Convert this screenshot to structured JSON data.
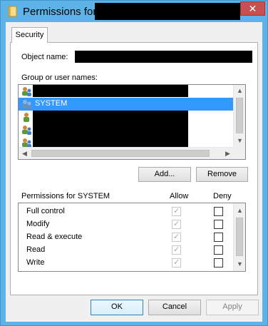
{
  "window": {
    "title": "Permissions for",
    "close_label": "✕"
  },
  "tabs": [
    {
      "label": "Security"
    }
  ],
  "object": {
    "label": "Object name:"
  },
  "users": {
    "label": "Group or user names:",
    "items": [
      {
        "label": "",
        "selected": false,
        "redacted": true
      },
      {
        "label": "SYSTEM",
        "selected": true,
        "redacted": false
      },
      {
        "label": "",
        "selected": false,
        "redacted": true
      },
      {
        "label": "",
        "selected": false,
        "redacted": true
      },
      {
        "label": "",
        "selected": false,
        "redacted": true
      }
    ]
  },
  "buttons": {
    "add": "Add...",
    "remove": "Remove",
    "ok": "OK",
    "cancel": "Cancel",
    "apply": "Apply"
  },
  "permissions": {
    "header": "Permissions for SYSTEM",
    "allow_header": "Allow",
    "deny_header": "Deny",
    "items": [
      {
        "name": "Full control",
        "allow": true,
        "deny": false
      },
      {
        "name": "Modify",
        "allow": true,
        "deny": false
      },
      {
        "name": "Read & execute",
        "allow": true,
        "deny": false
      },
      {
        "name": "Read",
        "allow": true,
        "deny": false
      },
      {
        "name": "Write",
        "allow": true,
        "deny": false
      }
    ]
  },
  "icons": {
    "title": "folder-icon",
    "user": "user-group-icon"
  },
  "colors": {
    "titlebar": "#5db3e8",
    "close": "#c75050",
    "selection": "#3399ff"
  }
}
